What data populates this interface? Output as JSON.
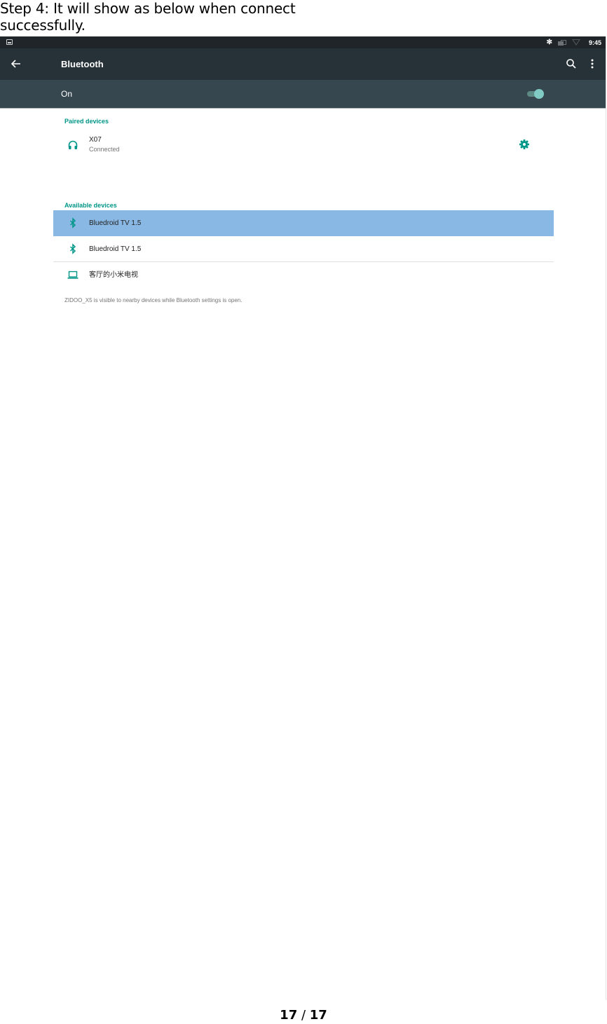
{
  "document": {
    "caption": "Step 4: It will show as below when connect successfully.",
    "page_current": "17",
    "page_separator": " / ",
    "page_total": "17"
  },
  "statusbar": {
    "notification_icon": "image-notification-icon",
    "icons": [
      "bluetooth-icon",
      "ethernet-icon",
      "wifi-icon"
    ],
    "time": "9:45"
  },
  "appbar": {
    "back_icon": "arrow-left-icon",
    "title": "Bluetooth",
    "search_icon": "search-icon",
    "more_icon": "more-vertical-icon"
  },
  "switchbar": {
    "label": "On",
    "toggle_state": "on",
    "accent": "#80cbc4"
  },
  "paired": {
    "header": "Paired devices",
    "devices": [
      {
        "name": "X07",
        "status": "Connected",
        "icon": "headphones-icon",
        "action_icon": "gear-icon"
      }
    ]
  },
  "available": {
    "header": "Available devices",
    "devices": [
      {
        "name": "Bluedroid TV 1.5",
        "icon": "bluetooth-icon",
        "highlighted": true
      },
      {
        "name": "Bluedroid TV 1.5",
        "icon": "bluetooth-icon",
        "highlighted": false
      },
      {
        "name": "客厅的小米电视",
        "icon": "laptop-icon",
        "highlighted": false
      }
    ]
  },
  "footer_note": "ZIDOO_X5 is visible to nearby devices while Bluetooth settings is open.",
  "colors": {
    "accent": "#009688",
    "appbar": "#263238",
    "switchbar": "#37474f",
    "statusbar": "#1f2528",
    "highlight": "#8ab8e4"
  }
}
